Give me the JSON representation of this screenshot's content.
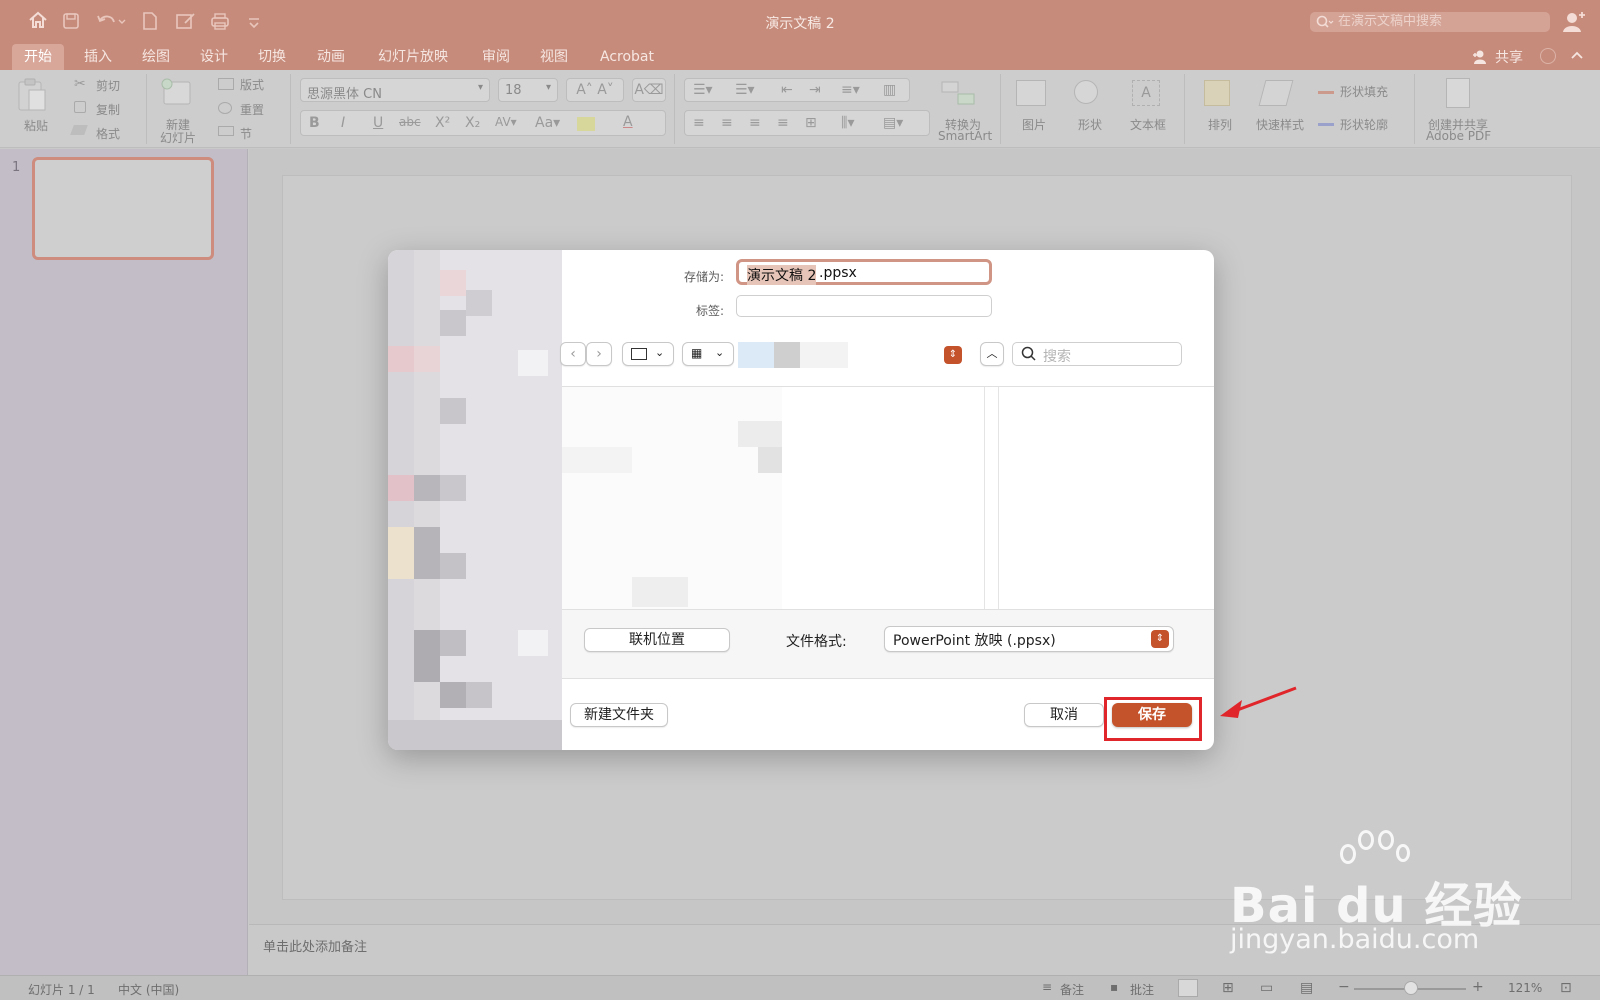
{
  "app": {
    "title": "演示文稿 2",
    "search_placeholder": "在演示文稿中搜索",
    "share_label": "共享",
    "accent_color": "#c68b7b"
  },
  "tabs": [
    "开始",
    "插入",
    "绘图",
    "设计",
    "切换",
    "动画",
    "幻灯片放映",
    "审阅",
    "视图",
    "Acrobat"
  ],
  "ribbon": {
    "paste": "粘贴",
    "cut": "剪切",
    "copy": "复制",
    "format": "格式",
    "new_slide": "新建",
    "new_slide_2": "幻灯片",
    "layout": "版式",
    "reset": "重置",
    "section": "节",
    "font_name": "思源黑体 CN",
    "font_size": "18",
    "convert_smartart_1": "转换为",
    "convert_smartart_2": "SmartArt",
    "picture": "图片",
    "shapes": "形状",
    "textbox": "文本框",
    "arrange": "排列",
    "quick_styles": "快速样式",
    "shape_fill": "形状填充",
    "shape_outline": "形状轮廓",
    "create_pdf_1": "创建并共享",
    "create_pdf_2": "Adobe PDF"
  },
  "slides_panel": {
    "slide_number": "1"
  },
  "notes_placeholder": "单击此处添加备注",
  "status": {
    "slide_count": "幻灯片 1 / 1",
    "language": "中文 (中国)",
    "notes": "备注",
    "comments": "批注",
    "zoom": "121%"
  },
  "dialog": {
    "save_as_label": "存储为:",
    "filename_selected": "演示文稿 2",
    "filename_ext": ".ppsx",
    "tags_label": "标签:",
    "search_placeholder": "搜索",
    "online_locations": "联机位置",
    "file_format_label": "文件格式:",
    "file_format_value": "PowerPoint 放映 (.ppsx)",
    "new_folder": "新建文件夹",
    "cancel": "取消",
    "save": "保存",
    "save_color": "#c4532b"
  },
  "watermark": {
    "brand": "Bai du 经验",
    "url": "jingyan.baidu.com"
  }
}
